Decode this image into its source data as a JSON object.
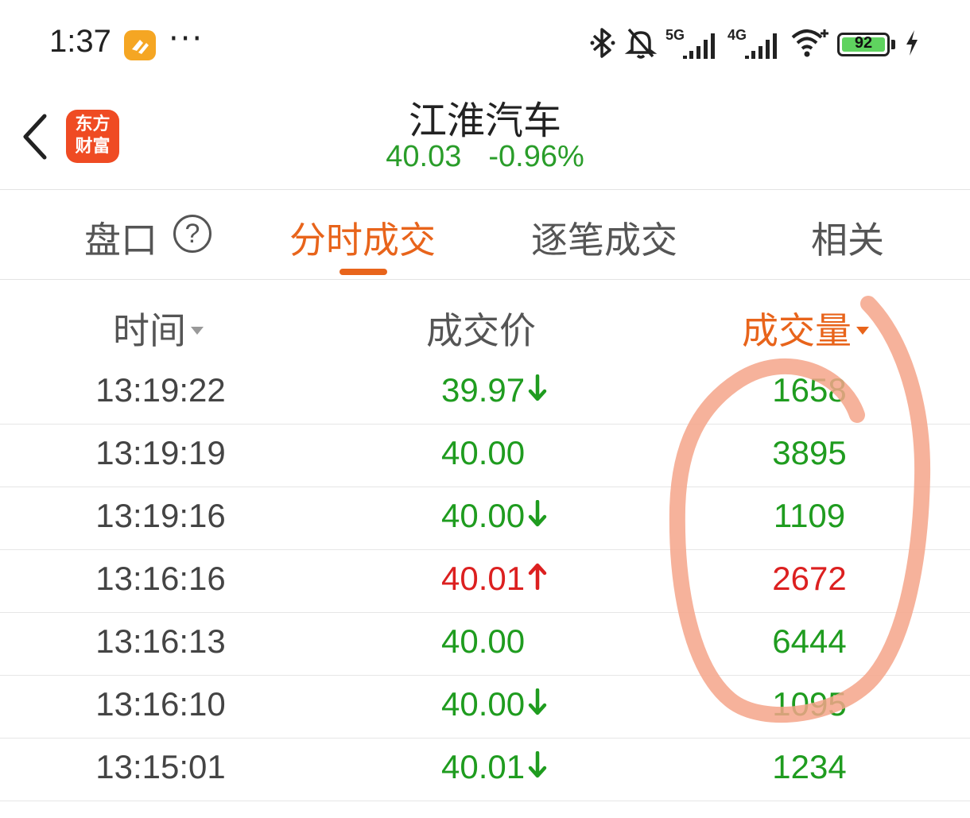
{
  "status_bar": {
    "time": "1:37",
    "overflow": "···",
    "signal_1_label": "5G",
    "signal_2_label": "4G",
    "battery_level": "92"
  },
  "header": {
    "logo_line1": "东方",
    "logo_line2": "财富",
    "title": "江淮汽车",
    "price": "40.03",
    "change": "-0.96%"
  },
  "tabs": [
    {
      "label": "盘口"
    },
    {
      "label": "分时成交"
    },
    {
      "label": "逐笔成交"
    },
    {
      "label": "相关"
    }
  ],
  "columns": {
    "time": "时间",
    "price": "成交价",
    "volume": "成交量"
  },
  "rows": [
    {
      "time": "13:19:22",
      "price": "39.97",
      "direction": "down",
      "volume": "1658",
      "color": "green"
    },
    {
      "time": "13:19:19",
      "price": "40.00",
      "direction": "none",
      "volume": "3895",
      "color": "green"
    },
    {
      "time": "13:19:16",
      "price": "40.00",
      "direction": "down",
      "volume": "1109",
      "color": "green"
    },
    {
      "time": "13:16:16",
      "price": "40.01",
      "direction": "up",
      "volume": "2672",
      "color": "red"
    },
    {
      "time": "13:16:13",
      "price": "40.00",
      "direction": "none",
      "volume": "6444",
      "color": "green"
    },
    {
      "time": "13:16:10",
      "price": "40.00",
      "direction": "down",
      "volume": "1095",
      "color": "green"
    },
    {
      "time": "13:15:01",
      "price": "40.01",
      "direction": "down",
      "volume": "1234",
      "color": "green"
    }
  ],
  "colors": {
    "accent": "#e8641b",
    "down": "#1f9c1f",
    "up": "#dc2020",
    "annotation": "#f4a58a"
  }
}
